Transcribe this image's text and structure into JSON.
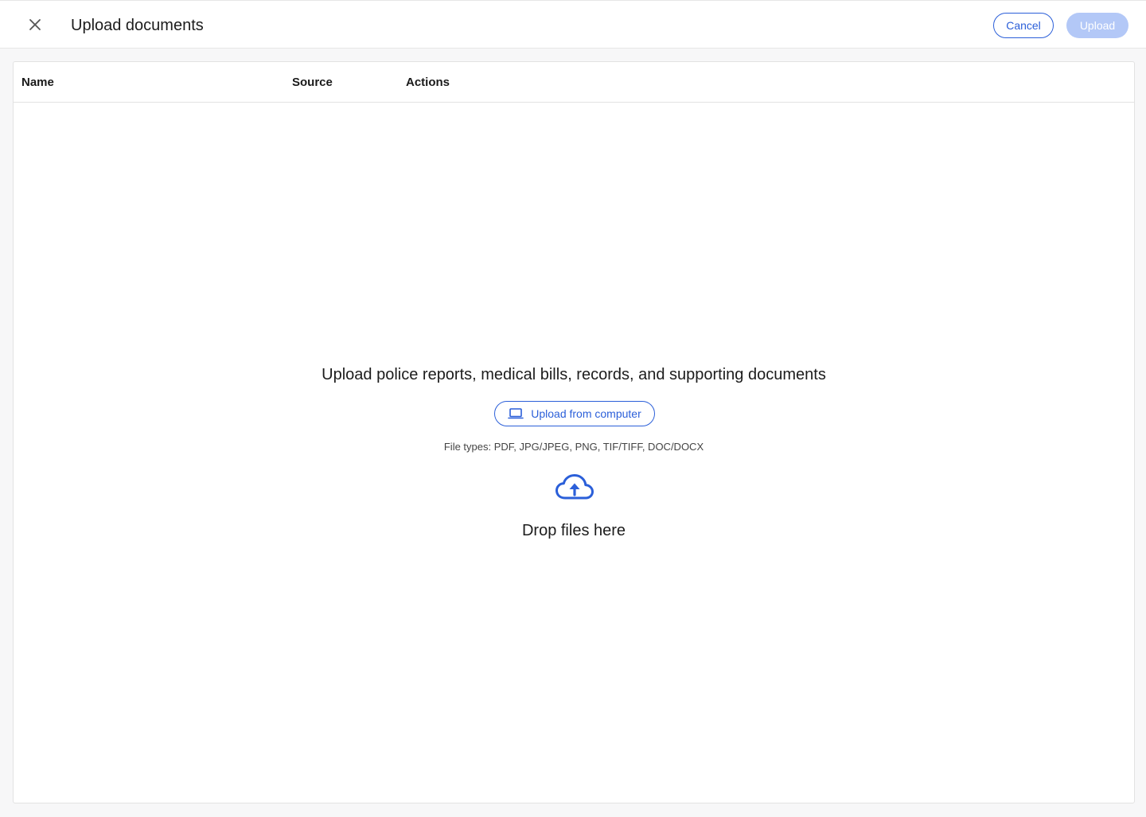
{
  "header": {
    "title": "Upload documents",
    "cancel_label": "Cancel",
    "upload_label": "Upload"
  },
  "table": {
    "columns": [
      "Name",
      "Source",
      "Actions"
    ]
  },
  "dropzone": {
    "headline": "Upload police reports, medical bills, records, and supporting documents",
    "upload_from_computer_label": "Upload from computer",
    "file_types": "File types: PDF, JPG/JPEG, PNG, TIF/TIFF, DOC/DOCX",
    "drop_text": "Drop files here"
  },
  "icons": {
    "close": "close-icon",
    "laptop": "laptop-icon",
    "cloud_upload": "cloud-upload-icon"
  },
  "colors": {
    "accent": "#2b5fd9",
    "upload_disabled_bg": "#b3c8f7"
  }
}
